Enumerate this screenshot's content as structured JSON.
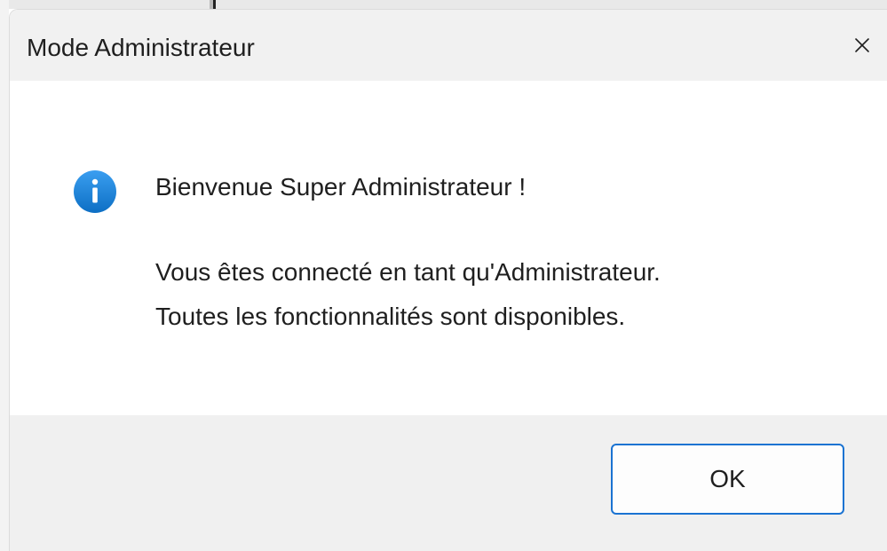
{
  "dialog": {
    "title": "Mode Administrateur",
    "close_icon": "close-icon",
    "info_icon": "info-icon",
    "message_line_1": "Bienvenue Super Administrateur !",
    "message_line_2": "Vous êtes connecté en tant qu'Administrateur.",
    "message_line_3": "Toutes les fonctionnalités sont disponibles.",
    "ok_label": "OK"
  },
  "colors": {
    "accent": "#1a73d2",
    "info_icon": "#1683d8",
    "titlebar_bg": "#f1f1f1",
    "footer_bg": "#f0f0f0"
  }
}
